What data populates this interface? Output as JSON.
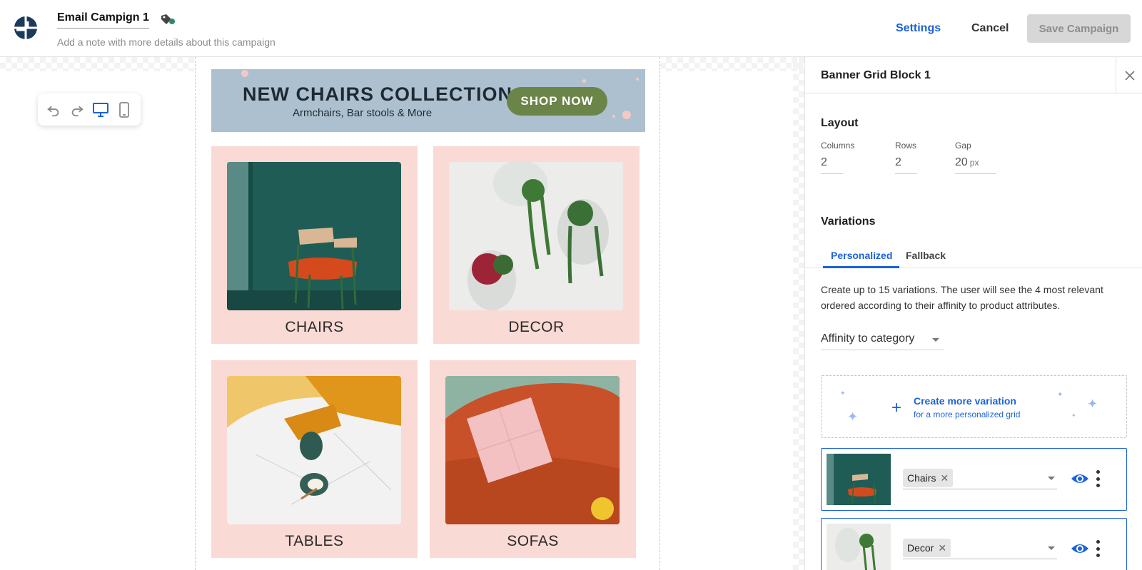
{
  "header": {
    "campaign_title": "Email Campign 1",
    "note_placeholder": "Add a note with more details about this campaign",
    "settings_label": "Settings",
    "cancel_label": "Cancel",
    "save_label": "Save Campaign",
    "brand_color": "#1b62d9"
  },
  "toolbar": {
    "icons": [
      "undo-icon",
      "redo-icon",
      "desktop-icon",
      "mobile-icon"
    ],
    "active": "desktop-icon"
  },
  "email": {
    "banner": {
      "title": "NEW CHAIRS COLLECTION",
      "subtitle": "Armchairs, Bar stools & More",
      "button_label": "SHOP NOW"
    },
    "cards": [
      {
        "label": "CHAIRS"
      },
      {
        "label": "DECOR"
      },
      {
        "label": "TABLES"
      },
      {
        "label": "SOFAS"
      }
    ]
  },
  "panel": {
    "title": "Banner Grid Block 1",
    "layout": {
      "title": "Layout",
      "columns_label": "Columns",
      "columns_value": "2",
      "rows_label": "Rows",
      "rows_value": "2",
      "gap_label": "Gap",
      "gap_value": "20",
      "gap_unit": "px"
    },
    "variations": {
      "title": "Variations",
      "tabs": [
        {
          "label": "Personalized",
          "active": true
        },
        {
          "label": "Fallback",
          "active": false
        }
      ],
      "description": "Create up to 15 variations. The user will see the 4 most relevant ordered according to their affinity to product attributes.",
      "affinity_select": "Affinity to category",
      "create_title": "Create more variation",
      "create_subtitle": "for a more personalized grid",
      "items": [
        {
          "tag": "Chairs"
        },
        {
          "tag": "Decor"
        }
      ]
    }
  }
}
